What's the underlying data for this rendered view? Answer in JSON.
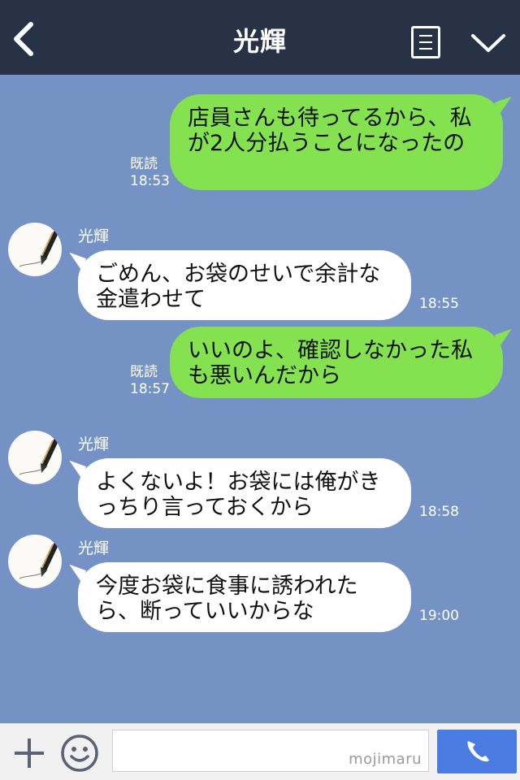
{
  "header": {
    "title": "光輝"
  },
  "messages": [
    {
      "side": "out",
      "text": "店員さんも待ってるから、私が2人分払うことになったの",
      "read": "既読",
      "time": "18:53"
    },
    {
      "side": "in",
      "sender": "光輝",
      "text": "ごめん、お袋のせいで余計な金遣わせて",
      "time": "18:55"
    },
    {
      "side": "out",
      "text": "いいのよ、確認しなかった私も悪いんだから",
      "read": "既読",
      "time": "18:57"
    },
    {
      "side": "in",
      "sender": "光輝",
      "text": "よくないよ！お袋には俺がきっちり言っておくから",
      "time": "18:58"
    },
    {
      "side": "in",
      "sender": "光輝",
      "text": "今度お袋に食事に誘われたら、断っていいからな",
      "time": "19:00"
    }
  ],
  "footer": {
    "input_value": "",
    "watermark": "mojimaru"
  },
  "icons": {
    "back": "chevron-left-icon",
    "menu": "list-icon",
    "more": "chevron-down-icon",
    "plus": "plus-icon",
    "emoji": "smile-icon",
    "call": "phone-icon",
    "avatar": "fountain-pen-avatar"
  },
  "colors": {
    "header_bg": "#273246",
    "chat_bg": "#7492c4",
    "outgoing_bubble": "#84e251",
    "incoming_bubble": "#ffffff",
    "call_button": "#4a7be0"
  }
}
